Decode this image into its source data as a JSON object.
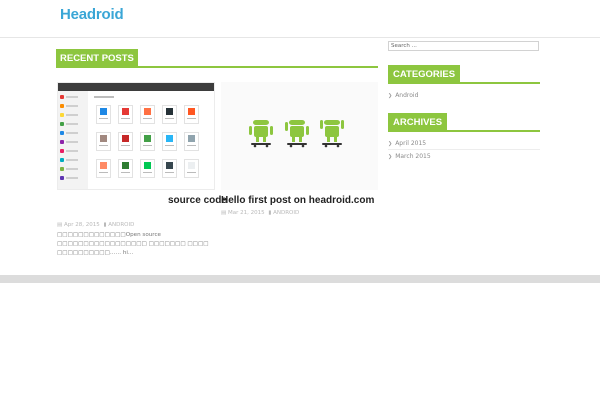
{
  "header": {
    "site_title": "Headroid"
  },
  "main": {
    "section_label": "RECENT POSTS",
    "posts": [
      {
        "title": "source code",
        "date": "Apr 28, 2015",
        "category": "ANDROID",
        "excerpt": "□□□□□□□□□□□□□Open source □□□□□□□□□□□□□□□□□ □□□□□□□ □□□□ □□□□□□□□□□…… hi…"
      },
      {
        "title": "Hello first post on headroid.com",
        "date": "Mar 21, 2015",
        "category": "ANDROID"
      }
    ]
  },
  "sidebar": {
    "search_placeholder": "Search ...",
    "categories_label": "CATEGORIES",
    "categories": [
      "Android"
    ],
    "archives_label": "ARCHIVES",
    "archives": [
      "April 2015",
      "March 2015"
    ]
  },
  "colors": {
    "accent": "#8dc63f",
    "title": "#3aa6d6"
  }
}
